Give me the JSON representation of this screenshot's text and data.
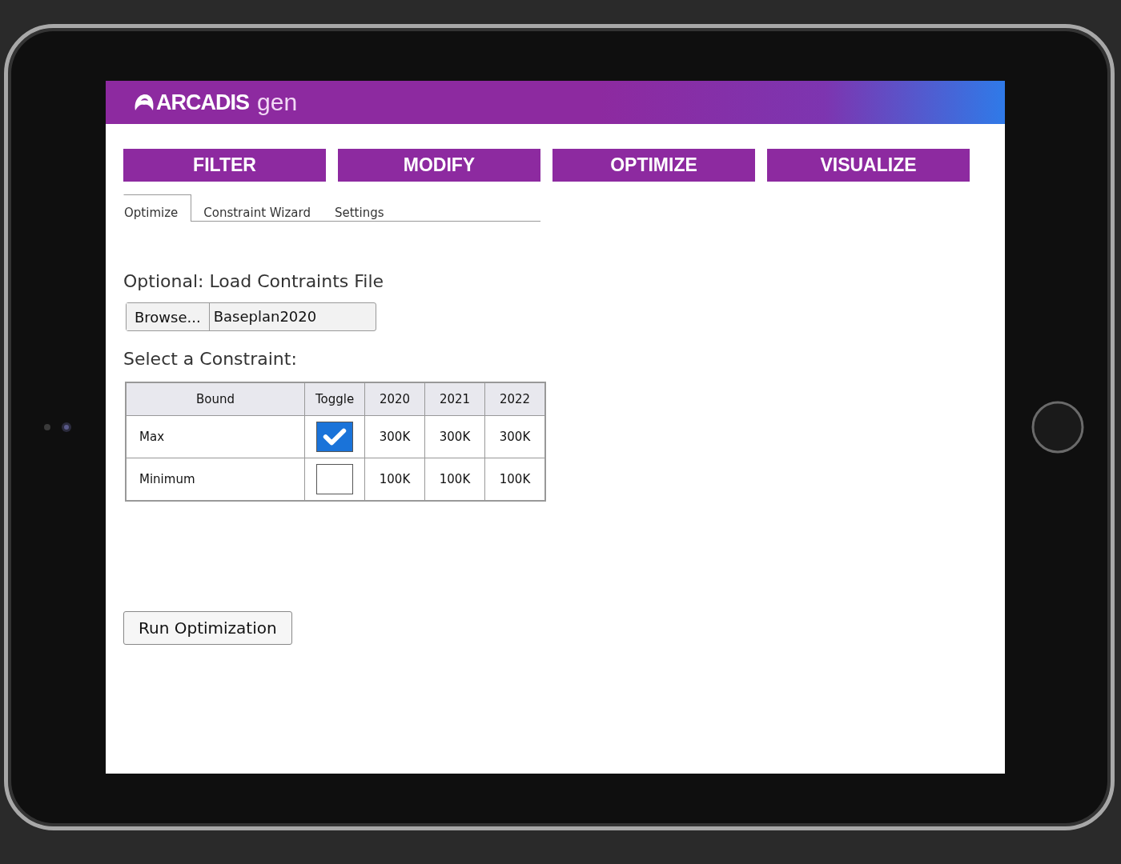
{
  "header": {
    "brand": "ARCADIS",
    "suffix": "gen"
  },
  "nav": [
    {
      "label": "FILTER"
    },
    {
      "label": "MODIFY"
    },
    {
      "label": "OPTIMIZE"
    },
    {
      "label": "VISUALIZE"
    }
  ],
  "tabs": [
    {
      "label": "Optimize",
      "selected": true
    },
    {
      "label": "Constraint Wizard",
      "selected": false
    },
    {
      "label": "Settings",
      "selected": false
    }
  ],
  "file_section": {
    "heading": "Optional: Load Contraints File",
    "browse": "Browse...",
    "value": "Baseplan2020"
  },
  "constraint_section": {
    "heading": "Select a Constraint:"
  },
  "table": {
    "columns": [
      "Bound",
      "Toggle",
      "2020",
      "2021",
      "2022"
    ],
    "rows": [
      {
        "bound": "Max",
        "checked": true,
        "values": [
          "300K",
          "300K",
          "300K"
        ]
      },
      {
        "bound": "Minimum",
        "checked": false,
        "values": [
          "100K",
          "100K",
          "100K"
        ]
      }
    ]
  },
  "run_button": "Run Optimization"
}
